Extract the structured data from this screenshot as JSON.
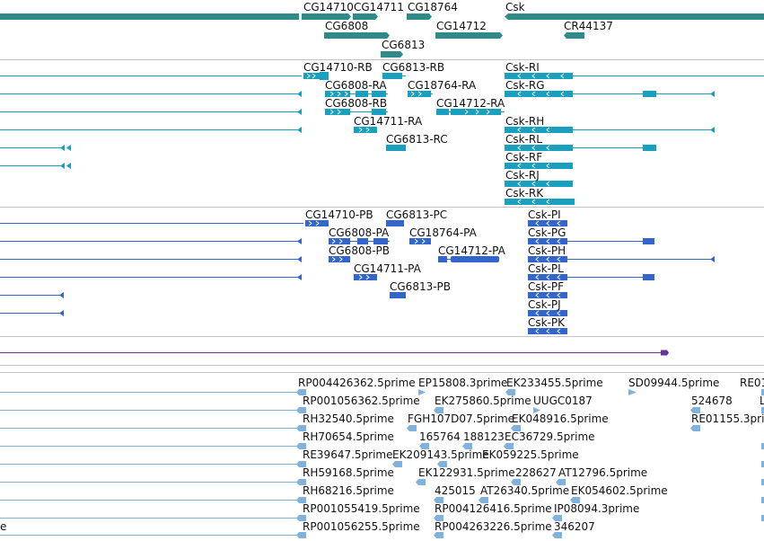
{
  "colors": {
    "gene": "#2f8a8a",
    "transcript": "#1aa0bf",
    "protein": "#3366cc",
    "repeat": "#663399",
    "est": "#7fb2dc",
    "separator": "#c4c4c4",
    "label": "#111111"
  },
  "gene_track": {
    "labels": [
      {
        "text": "CG14710",
        "id": "cg14710"
      },
      {
        "text": "CG14711",
        "id": "cg14711"
      },
      {
        "text": "CG18764",
        "id": "cg18764"
      },
      {
        "text": "Csk",
        "id": "csk"
      },
      {
        "text": "CG6808",
        "id": "cg6808"
      },
      {
        "text": "CG14712",
        "id": "cg14712"
      },
      {
        "text": "CR44137",
        "id": "cr44137"
      },
      {
        "text": "CG6813",
        "id": "cg6813"
      }
    ]
  },
  "transcript_track": {
    "labels": [
      {
        "text": "CG14710-RB",
        "id": "cg14710-rb"
      },
      {
        "text": "CG6813-RB",
        "id": "cg6813-rb"
      },
      {
        "text": "Csk-RI",
        "id": "csk-ri"
      },
      {
        "text": "CG6808-RA",
        "id": "cg6808-ra"
      },
      {
        "text": "CG18764-RA",
        "id": "cg18764-ra"
      },
      {
        "text": "Csk-RG",
        "id": "csk-rg"
      },
      {
        "text": "CG6808-RB",
        "id": "cg6808-rb"
      },
      {
        "text": "CG14712-RA",
        "id": "cg14712-ra"
      },
      {
        "text": "CG14711-RA",
        "id": "cg14711-ra"
      },
      {
        "text": "Csk-RH",
        "id": "csk-rh"
      },
      {
        "text": "CG6813-RC",
        "id": "cg6813-rc"
      },
      {
        "text": "Csk-RL",
        "id": "csk-rl"
      },
      {
        "text": "Csk-RF",
        "id": "csk-rf"
      },
      {
        "text": "Csk-RJ",
        "id": "csk-rj"
      },
      {
        "text": "Csk-RK",
        "id": "csk-rk"
      }
    ]
  },
  "protein_track": {
    "labels": [
      {
        "text": "CG14710-PB",
        "id": "cg14710-pb"
      },
      {
        "text": "CG6813-PC",
        "id": "cg6813-pc"
      },
      {
        "text": "Csk-PI",
        "id": "csk-pi"
      },
      {
        "text": "CG6808-PA",
        "id": "cg6808-pa"
      },
      {
        "text": "CG18764-PA",
        "id": "cg18764-pa"
      },
      {
        "text": "Csk-PG",
        "id": "csk-pg"
      },
      {
        "text": "CG6808-PB",
        "id": "cg6808-pb"
      },
      {
        "text": "CG14712-PA",
        "id": "cg14712-pa"
      },
      {
        "text": "Csk-PH",
        "id": "csk-ph"
      },
      {
        "text": "CG14711-PA",
        "id": "cg14711-pa"
      },
      {
        "text": "Csk-PL",
        "id": "csk-pl"
      },
      {
        "text": "CG6813-PB",
        "id": "cg6813-pb"
      },
      {
        "text": "Csk-PF",
        "id": "csk-pf"
      },
      {
        "text": "Csk-PJ",
        "id": "csk-pj"
      },
      {
        "text": "Csk-PK",
        "id": "csk-pk"
      }
    ]
  },
  "est_track": {
    "labels": [
      {
        "text": "RP004426362.5prime",
        "id": "rp004426362"
      },
      {
        "text": "EP15808.3prime",
        "id": "ep15808"
      },
      {
        "text": "EK233455.5prime",
        "id": "ek233455"
      },
      {
        "text": "SD09944.5prime",
        "id": "sd09944"
      },
      {
        "text": "RE01",
        "id": "re01-cut"
      },
      {
        "text": "RP001056362.5prime",
        "id": "rp001056362"
      },
      {
        "text": "EK275860.5prime",
        "id": "ek275860"
      },
      {
        "text": "UUGC0187",
        "id": "uugc0187"
      },
      {
        "text": "524678",
        "id": "est-524678"
      },
      {
        "text": "L",
        "id": "l-cut"
      },
      {
        "text": "RH32540.5prime",
        "id": "rh32540"
      },
      {
        "text": "FGH107D07.5prime",
        "id": "fgh107d07"
      },
      {
        "text": "EK048916.5prime",
        "id": "ek048916"
      },
      {
        "text": "RE01155.3prime",
        "id": "re01155"
      },
      {
        "text": "RH70654.5prime",
        "id": "rh70654"
      },
      {
        "text": "165764",
        "id": "est-165764"
      },
      {
        "text": "188123",
        "id": "est-188123"
      },
      {
        "text": "EC36729.5prime",
        "id": "ec36729"
      },
      {
        "text": "RE39647.5prime",
        "id": "re39647"
      },
      {
        "text": "EK209143.5prime",
        "id": "ek209143"
      },
      {
        "text": "EK059225.5prime",
        "id": "ek059225"
      },
      {
        "text": "RH59168.5prime",
        "id": "rh59168"
      },
      {
        "text": "EK122931.5prime",
        "id": "ek122931"
      },
      {
        "text": "228627",
        "id": "est-228627"
      },
      {
        "text": "AT12796.5prime",
        "id": "at12796"
      },
      {
        "text": "RH68216.5prime",
        "id": "rh68216"
      },
      {
        "text": "425015",
        "id": "est-425015"
      },
      {
        "text": "AT26340.5prime",
        "id": "at26340"
      },
      {
        "text": "EK054602.5prime",
        "id": "ek054602"
      },
      {
        "text": "RP001055419.5prime",
        "id": "rp001055419"
      },
      {
        "text": "RP004126416.5prime",
        "id": "rp004126416"
      },
      {
        "text": "IP08094.3prime",
        "id": "ip08094"
      },
      {
        "text": "e",
        "id": "e-cut"
      },
      {
        "text": "RP001056255.5prime",
        "id": "rp001056255"
      },
      {
        "text": "RP004263226.5prime",
        "id": "rp004263226"
      },
      {
        "text": "346207",
        "id": "est-346207"
      }
    ]
  }
}
